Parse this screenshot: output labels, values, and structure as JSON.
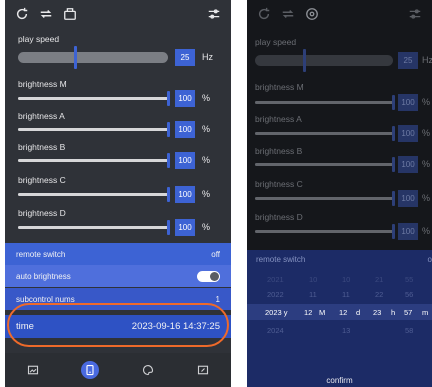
{
  "left": {
    "play_speed_label": "play speed",
    "play_speed_value": "25",
    "play_speed_unit": "Hz",
    "brightness": [
      {
        "label": "brightness M",
        "value": "100",
        "unit": "%",
        "level": 1.0
      },
      {
        "label": "brightness A",
        "value": "100",
        "unit": "%",
        "level": 1.0
      },
      {
        "label": "brightness B",
        "value": "100",
        "unit": "%",
        "level": 1.0
      },
      {
        "label": "brightness C",
        "value": "100",
        "unit": "%",
        "level": 1.0
      },
      {
        "label": "brightness D",
        "value": "100",
        "unit": "%",
        "level": 1.0
      }
    ],
    "remote_switch_label": "remote switch",
    "remote_switch_value": "off",
    "auto_brightness_label": "auto brightness",
    "subcontrol_label": "subcontrol nums",
    "subcontrol_value": "1",
    "time_label": "time",
    "time_value": "2023-09-16 14:37:25"
  },
  "right": {
    "play_speed_label": "play speed",
    "play_speed_value": "25",
    "play_speed_unit": "Hz",
    "brightness": [
      {
        "label": "brightness M",
        "value": "100",
        "unit": "%"
      },
      {
        "label": "brightness A",
        "value": "100",
        "unit": "%"
      },
      {
        "label": "brightness B",
        "value": "100",
        "unit": "%"
      },
      {
        "label": "brightness C",
        "value": "100",
        "unit": "%"
      },
      {
        "label": "brightness D",
        "value": "100",
        "unit": "%"
      }
    ],
    "remote_switch_label": "remote switch",
    "remote_switch_value": "o",
    "picker": {
      "rows": [
        [
          "2021",
          "10",
          "10",
          "21",
          "55"
        ],
        [
          "2022",
          "11",
          "11",
          "22",
          "56"
        ],
        [
          "2023 y",
          "12",
          "M",
          "12",
          "d",
          "23",
          "h",
          "57",
          "m"
        ],
        [
          "2024",
          "",
          "13",
          "",
          "58"
        ]
      ],
      "confirm": "confirm"
    }
  }
}
